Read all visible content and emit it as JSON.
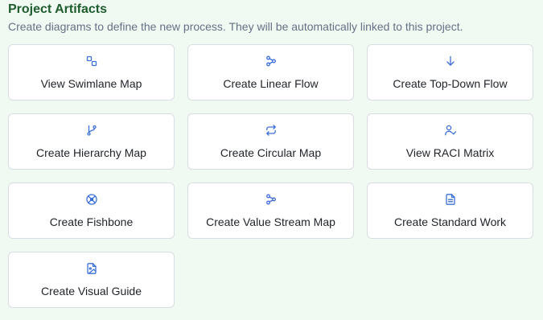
{
  "header": {
    "title": "Project Artifacts",
    "subtitle": "Create diagrams to define the new process. They will be automatically linked to this project."
  },
  "colors": {
    "accent": "#3b6fd8",
    "title": "#1e5c2e",
    "background": "#f0faf2"
  },
  "artifacts": [
    {
      "label": "View Swimlane Map",
      "icon": "swimlane-icon"
    },
    {
      "label": "Create Linear Flow",
      "icon": "linear-flow-icon"
    },
    {
      "label": "Create Top-Down Flow",
      "icon": "arrow-down-icon"
    },
    {
      "label": "Create Hierarchy Map",
      "icon": "git-branch-icon"
    },
    {
      "label": "Create Circular Map",
      "icon": "repeat-icon"
    },
    {
      "label": "View RACI Matrix",
      "icon": "user-check-icon"
    },
    {
      "label": "Create Fishbone",
      "icon": "fishbone-icon"
    },
    {
      "label": "Create Value Stream Map",
      "icon": "value-stream-icon"
    },
    {
      "label": "Create Standard Work",
      "icon": "document-icon"
    },
    {
      "label": "Create Visual Guide",
      "icon": "image-file-icon"
    }
  ]
}
